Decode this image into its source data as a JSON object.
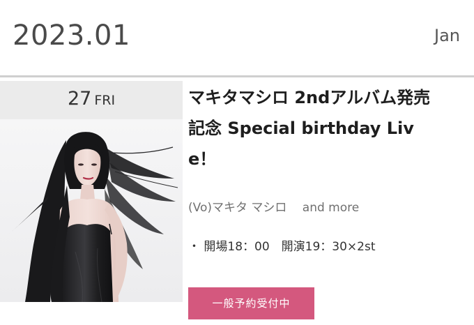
{
  "header": {
    "year_month": "2023.01",
    "month_en": "Jan"
  },
  "event": {
    "day": "27",
    "weekday": "FRI",
    "title": "マキタマシロ 2ndアルバム発売記念 Special birthday Live！",
    "performers": "(Vo)マキタ マシロ　 and more",
    "schedule": "・ 開場18：00　開演19：30×2st",
    "reserve_label": "一般予約受付中"
  },
  "colors": {
    "accent_button": "#d4587e",
    "date_box_bg": "#ebebeb",
    "divider": "#cfcfcf"
  }
}
